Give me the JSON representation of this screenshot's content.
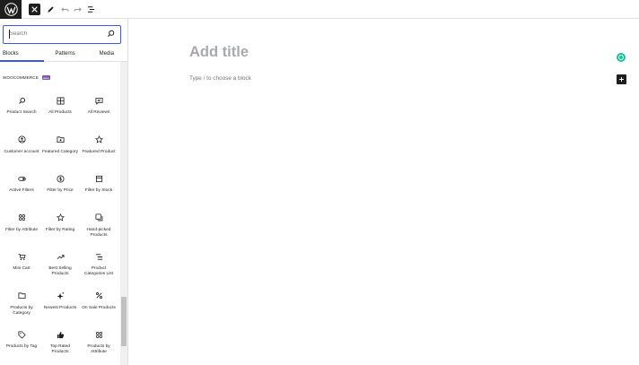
{
  "toolbar": {
    "logo_icon": "wordpress-icon",
    "close_icon": "close-icon",
    "tools_icon": "pencil-icon",
    "undo_icon": "undo-icon",
    "redo_icon": "redo-icon",
    "list_view_icon": "list-view-icon"
  },
  "inserter": {
    "search": {
      "placeholder": "Search",
      "value": ""
    },
    "tabs": [
      {
        "label": "Blocks",
        "active": true
      },
      {
        "label": "Patterns",
        "active": false
      },
      {
        "label": "Media",
        "active": false
      }
    ],
    "category": {
      "name": "WOOCOMMERCE",
      "badge": "woo"
    },
    "blocks": [
      {
        "label": "Product Search",
        "icon": "search-icon"
      },
      {
        "label": "All Products",
        "icon": "grid-icon"
      },
      {
        "label": "All Reviews",
        "icon": "reviews-icon"
      },
      {
        "label": "Customer account",
        "icon": "user-circle-icon"
      },
      {
        "label": "Featured Category",
        "icon": "folder-star-icon"
      },
      {
        "label": "Featured Product",
        "icon": "star-icon"
      },
      {
        "label": "Active Filters",
        "icon": "toggle-icon"
      },
      {
        "label": "Filter by Price",
        "icon": "dollar-circle-icon"
      },
      {
        "label": "Filter by Stock",
        "icon": "box-icon"
      },
      {
        "label": "Filter by Attribute",
        "icon": "attributes-icon"
      },
      {
        "label": "Filter by Rating",
        "icon": "star-outline-icon"
      },
      {
        "label": "Hand-picked Products",
        "icon": "hand-picked-icon"
      },
      {
        "label": "Mini Cart",
        "icon": "cart-icon"
      },
      {
        "label": "Best Selling Products",
        "icon": "trending-icon"
      },
      {
        "label": "Product Categories List",
        "icon": "list-icon"
      },
      {
        "label": "Products by Category",
        "icon": "folder-icon"
      },
      {
        "label": "Newest Products",
        "icon": "sparkle-icon"
      },
      {
        "label": "On Sale Products",
        "icon": "percent-icon"
      },
      {
        "label": "Products by Tag",
        "icon": "tag-icon"
      },
      {
        "label": "Top Rated Products",
        "icon": "thumbs-up-icon"
      },
      {
        "label": "Products by Attribute",
        "icon": "attributes-icon"
      }
    ]
  },
  "editor": {
    "title_placeholder": "Add title",
    "block_placeholder": "Type / to choose a block",
    "add_block_icon": "plus-icon",
    "grammarly_icon": "grammarly-icon"
  },
  "colors": {
    "accent": "#3858e9",
    "woo_badge": "#7f54b3",
    "grammarly": "#15c39a",
    "dark": "#1e1e1e"
  }
}
